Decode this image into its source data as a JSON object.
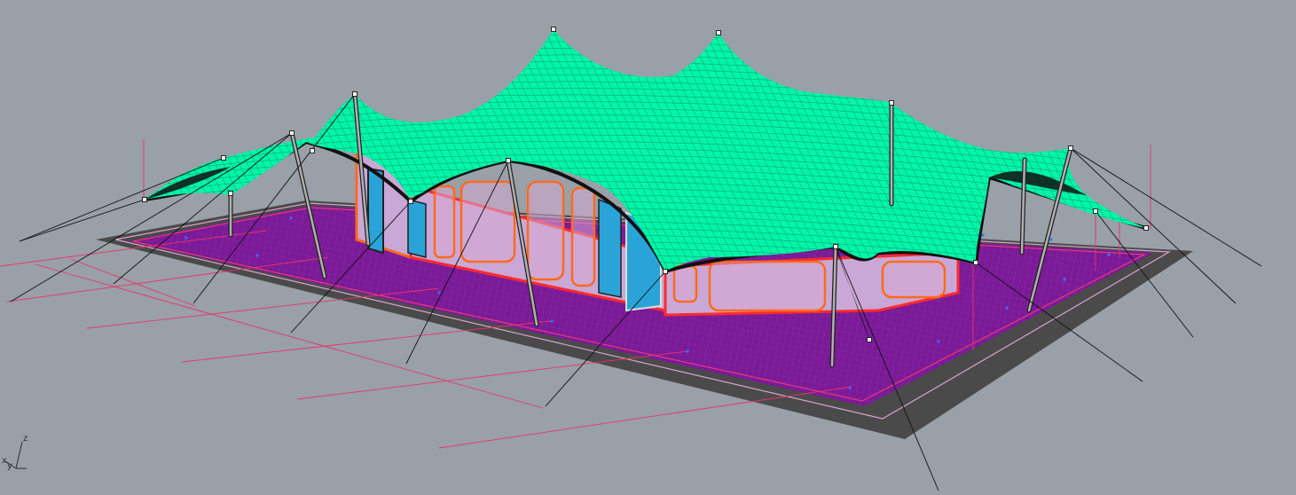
{
  "viewport": {
    "background": "#99a0a8",
    "axis_labels": {
      "z": "z",
      "x": "x",
      "y": "y"
    }
  },
  "model": {
    "membrane_color": "#00f5a8",
    "mesh_line_color": "#0a7a55",
    "deck_color": "#7a1a96",
    "deck_mesh_color": "#a13dc0",
    "base_border_color": "#4a4a4a",
    "guide_line_color": "#e8336a",
    "cable_color": "#111111",
    "mast_color": "#8a8a8a",
    "facade_frame_color": "#ff6a1e",
    "facade_glass_color": "#c9a7d6",
    "door_color": "#2aa4d8",
    "control_point_color": "#ffffff"
  }
}
